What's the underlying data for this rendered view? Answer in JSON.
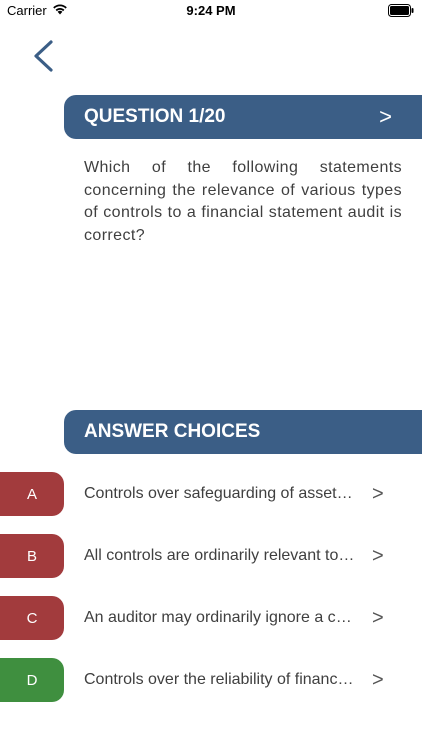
{
  "status_bar": {
    "carrier": "Carrier",
    "time": "9:24 PM"
  },
  "question": {
    "header": "QUESTION 1/20",
    "next_label": ">",
    "text": "Which of the following statements concerning the relevance of various types of controls to a financial statement audit is correct?"
  },
  "answers": {
    "header": "ANSWER CHOICES",
    "choices": [
      {
        "letter": "A",
        "text": "Controls over safeguarding of assets and recording of transactions are relevant",
        "chevron": ">",
        "color": "#a23b3d"
      },
      {
        "letter": "B",
        "text": "All controls are ordinarily relevant to the audit",
        "chevron": ">",
        "color": "#a23b3d"
      },
      {
        "letter": "C",
        "text": "An auditor may ordinarily ignore a consideration of controls",
        "chevron": ">",
        "color": "#a23b3d"
      },
      {
        "letter": "D",
        "text": "Controls over the reliability of financial reporting are ordinarily relevant",
        "chevron": ">",
        "color": "#3f8f3f"
      }
    ]
  },
  "colors": {
    "banner": "#3b5e86",
    "back_chevron": "#3b5e86"
  }
}
